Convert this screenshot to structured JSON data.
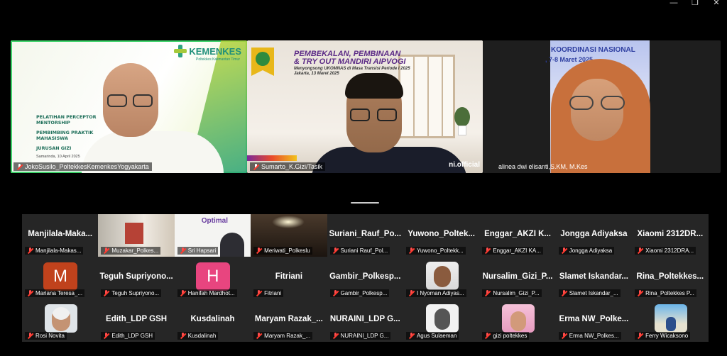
{
  "window": {
    "controls": [
      "—",
      "❐",
      "✕"
    ]
  },
  "speakers": [
    {
      "name": "JokoSusilo_PoltekkesKemenkesYogyakarta",
      "active": true,
      "slide": {
        "logo": "KEMENKES",
        "logo_sub": "Poltekkes Kalimantan Timur",
        "lines": [
          "PELATIHAN PERCEPTOR",
          "MENTORSHIP",
          "PEMBIMBING PRAKTIK",
          "MAHASISWA",
          "JURUSAN GIZI"
        ],
        "date": "Samarinda, 10 April 2025"
      }
    },
    {
      "name": "Sumarto_K.Gizi/Tasik",
      "active": false,
      "banner": {
        "title_1": "PEMBEKALAN, PEMBINAAN",
        "title_2": "& TRY OUT MANDIRI AIPVOGI",
        "sub_1": "Menyongsong UKOMNAS di Masa Transisi Periode I 2025",
        "sub_2": "Jakarta, 13 Maret 2025"
      },
      "watermark": "ni.official"
    },
    {
      "name": "alinea dwi elisanti,S.KM, M.Kes",
      "active": false,
      "screen_line_1": "KOORDINASI NASIONAL",
      "screen_line_2": ", 7-8 Maret 2025"
    }
  ],
  "gallery": [
    {
      "title": "Manjilala-Maka...",
      "label": "Manjilala-Makas...",
      "type": "name"
    },
    {
      "title": "",
      "label": "Muzakar_Polkes...",
      "type": "video",
      "video": "vid-muzakar"
    },
    {
      "title": "",
      "label": "Sri Hapsari",
      "type": "video",
      "video": "vid-sri",
      "video_text": "Optimal"
    },
    {
      "title": "",
      "label": "Meriwati_Polkeslu",
      "type": "video",
      "video": "vid-meri"
    },
    {
      "title": "Suriani_Rauf_Po...",
      "label": "Suriani Rauf_Pol...",
      "type": "name"
    },
    {
      "title": "Yuwono_Poltek...",
      "label": "Yuwono_Poltekk...",
      "type": "name"
    },
    {
      "title": "Enggar_AKZI K...",
      "label": "Enggar_AKZI KA...",
      "type": "name"
    },
    {
      "title": "Jongga Adiyaksa",
      "label": "Jongga Adiyaksa",
      "type": "name"
    },
    {
      "title": "Xiaomi 2312DR...",
      "label": "Xiaomi 2312DRA...",
      "type": "name"
    },
    {
      "title": "",
      "label": "Mariana Teresa_...",
      "type": "letter",
      "letter": "M",
      "color": "#c0421c"
    },
    {
      "title": "Teguh Supriyono...",
      "label": "Teguh Supriyono...",
      "type": "name"
    },
    {
      "title": "",
      "label": "Hanifah Mardhot...",
      "type": "letter",
      "letter": "H",
      "color": "#e8457f"
    },
    {
      "title": "Fitriani",
      "label": "Fitriani",
      "type": "name"
    },
    {
      "title": "Gambir_Polkesp...",
      "label": "Gambir_Polkesp...",
      "type": "name"
    },
    {
      "title": "",
      "label": "I Nyoman Adiyas...",
      "type": "photo",
      "photo": "ph-nyoman"
    },
    {
      "title": "Nursalim_Gizi_P...",
      "label": "Nursalim_Gizi_P...",
      "type": "name"
    },
    {
      "title": "Slamet Iskandar...",
      "label": "Slamet Iskandar_...",
      "type": "name"
    },
    {
      "title": "Rina_Poltekkes...",
      "label": "Rina_Poltekkes P...",
      "type": "name"
    },
    {
      "title": "",
      "label": "Rosi Novita",
      "type": "photo",
      "photo": "ph-rosi"
    },
    {
      "title": "Edith_LDP GSH",
      "label": "Edith_LDP GSH",
      "type": "name"
    },
    {
      "title": "Kusdalinah",
      "label": "Kusdalinah",
      "type": "name"
    },
    {
      "title": "Maryam Razak_...",
      "label": "Maryam Razak_...",
      "type": "name"
    },
    {
      "title": "NURAINI_LDP G...",
      "label": "NURAINI_LDP G...",
      "type": "name"
    },
    {
      "title": "",
      "label": "Agus Sulaeman",
      "type": "photo",
      "photo": "ph-agus"
    },
    {
      "title": "",
      "label": "gizi poltekkes",
      "type": "photo",
      "photo": "ph-gizi"
    },
    {
      "title": "Erma NW_Polke...",
      "label": "Erma NW_Polkes...",
      "type": "name"
    },
    {
      "title": "",
      "label": "Ferry Wicaksono",
      "type": "photo",
      "photo": "ph-ferry"
    }
  ]
}
